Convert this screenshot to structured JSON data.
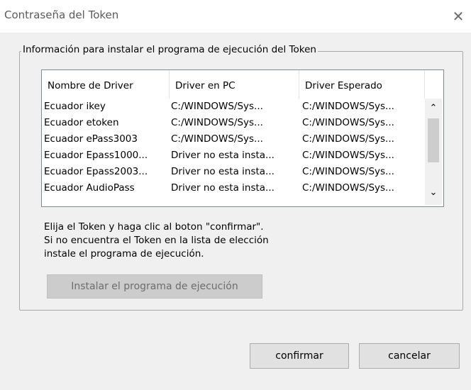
{
  "window": {
    "title": "Contraseña del Token",
    "close_symbol": "✕"
  },
  "group": {
    "legend": "Información para instalar el programa de ejecución del Token"
  },
  "table": {
    "columns": [
      "Nombre de Driver",
      "Driver en PC",
      "Driver Esperado"
    ],
    "rows": [
      [
        "Ecuador ikey",
        "C:/WINDOWS/Sys...",
        "C:/WINDOWS/Sys..."
      ],
      [
        "Ecuador etoken",
        "C:/WINDOWS/Sys...",
        "C:/WINDOWS/Sys..."
      ],
      [
        "Ecuador ePass3003",
        "C:/WINDOWS/Sys...",
        "C:/WINDOWS/Sys..."
      ],
      [
        "Ecuador Epass1000...",
        "Driver no esta insta...",
        "C:/WINDOWS/Sys..."
      ],
      [
        "Ecuador Epass2003...",
        "Driver no esta insta...",
        "C:/WINDOWS/Sys..."
      ],
      [
        "Ecuador AudioPass",
        "Driver no esta insta...",
        "C:/WINDOWS/Sys..."
      ]
    ],
    "scroll_up_symbol": "⌃",
    "scroll_down_symbol": "⌄"
  },
  "instructions": {
    "line1": "Elija el Token y haga clic al boton \"confirmar\".",
    "line2": "Si no encuentra el Token en la lista de elección",
    "line3": "instale el programa de ejecución."
  },
  "buttons": {
    "install": "Instalar el programa de ejecución",
    "confirm": "confirmar",
    "cancel": "cancelar"
  },
  "icons": {
    "close": "close-icon",
    "scroll_up": "chevron-up-icon",
    "scroll_down": "chevron-down-icon"
  }
}
